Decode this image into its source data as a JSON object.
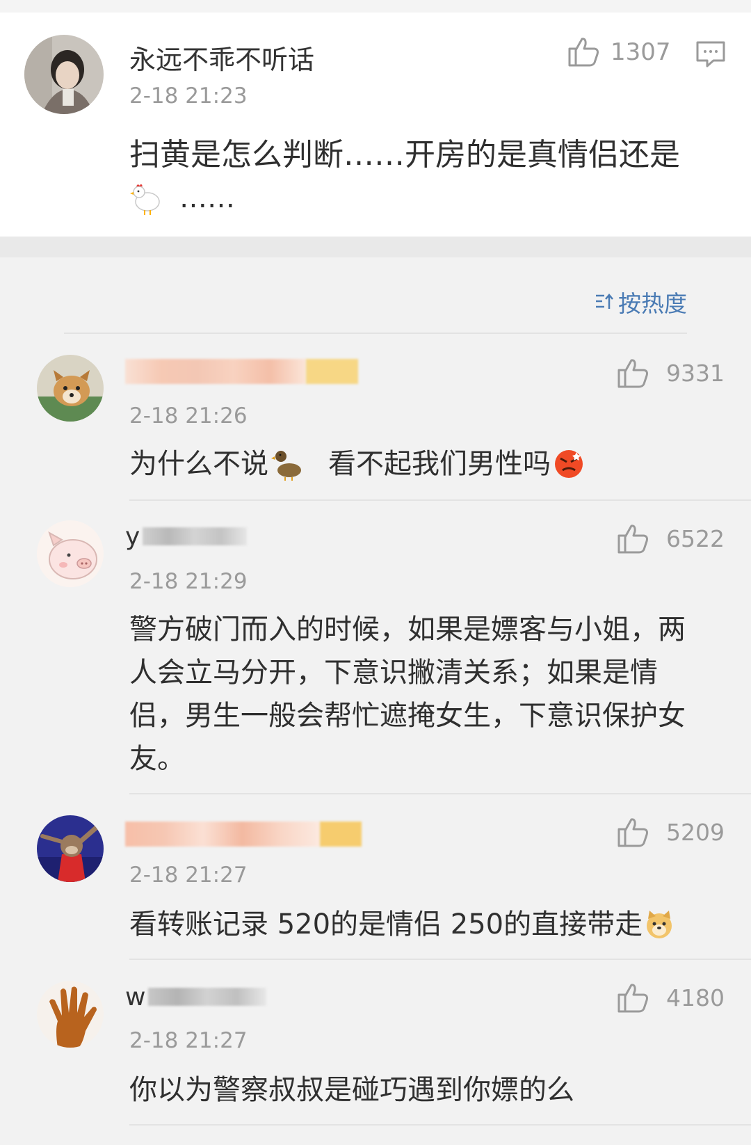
{
  "main_post": {
    "username": "永远不乖不听话",
    "time": "2-18 21:23",
    "likes": "1307",
    "content_line1": "扫黄是怎么判断……开房的是真情侣还是",
    "content_line2": "……",
    "content_emoji": "chicken-emoji"
  },
  "sort_label": "按热度",
  "comments": [
    {
      "username": "",
      "time": "2-18 21:26",
      "likes": "9331",
      "text_before": "为什么不说",
      "emoji1": "duck-emoji",
      "text_mid": "看不起我们男性吗",
      "emoji2": "angry-emoji"
    },
    {
      "username_initial": "y",
      "time": "2-18 21:29",
      "likes": "6522",
      "lines": [
        "警方破门而入的时候，如果是嫖客与小姐，两",
        "人会立马分开，下意识撇清关系；如果是情",
        "侣，男生一般会帮忙遮掩女生，下意识保护女",
        "友。"
      ]
    },
    {
      "username": "",
      "time": "2-18 21:27",
      "likes": "5209",
      "text": "看转账记录 520的是情侣 250的直接带走",
      "emoji": "doge-emoji"
    },
    {
      "username_initial": "w",
      "time": "2-18 21:27",
      "likes": "4180",
      "text": "你以为警察叔叔是碰巧遇到你嫖的么"
    }
  ],
  "colors": {
    "link_blue": "#4a7bb4",
    "meta_gray": "#9a9a9a",
    "text_dark": "#2f2f2f"
  }
}
